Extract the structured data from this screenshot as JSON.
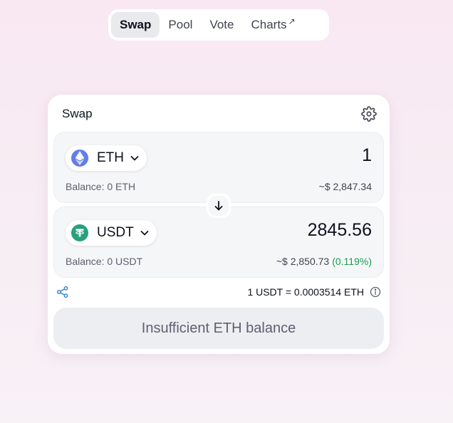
{
  "nav": {
    "items": [
      {
        "label": "Swap",
        "active": true
      },
      {
        "label": "Pool"
      },
      {
        "label": "Vote"
      },
      {
        "label": "Charts",
        "suffix": "↗"
      }
    ]
  },
  "card": {
    "title": "Swap",
    "from": {
      "token": "ETH",
      "amount": "1",
      "balance": "Balance: 0 ETH",
      "usd": "~$ 2,847.34"
    },
    "to": {
      "token": "USDT",
      "amount": "2845.56",
      "balance": "Balance: 0 USDT",
      "usd": "~$ 2,850.73",
      "usd_pct": "(0.119%)"
    },
    "rate": "1 USDT = 0.0003514 ETH",
    "action_label": "Insufficient ETH balance"
  },
  "colors": {
    "eth": "#627eea",
    "usdt": "#26a17b",
    "positive": "#1d9a52"
  }
}
